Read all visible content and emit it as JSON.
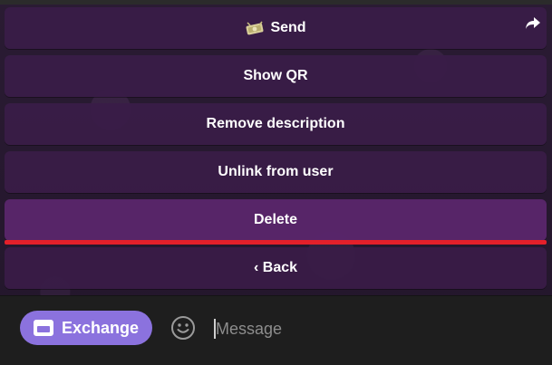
{
  "keyboard": {
    "buttons": [
      {
        "label": "Send",
        "icon": "money-bag-emoji"
      },
      {
        "label": "Show QR"
      },
      {
        "label": "Remove description"
      },
      {
        "label": "Unlink from user"
      },
      {
        "label": "Delete"
      },
      {
        "label": "‹ Back"
      }
    ]
  },
  "input_bar": {
    "exchange_label": "Exchange",
    "message_placeholder": "Message"
  },
  "colors": {
    "button_bg": "#3a1c48",
    "highlight_bg": "#5a266c",
    "underline": "#e3202a",
    "exchange_bg": "#8b72de",
    "input_bar_bg": "#1e1e1e"
  }
}
